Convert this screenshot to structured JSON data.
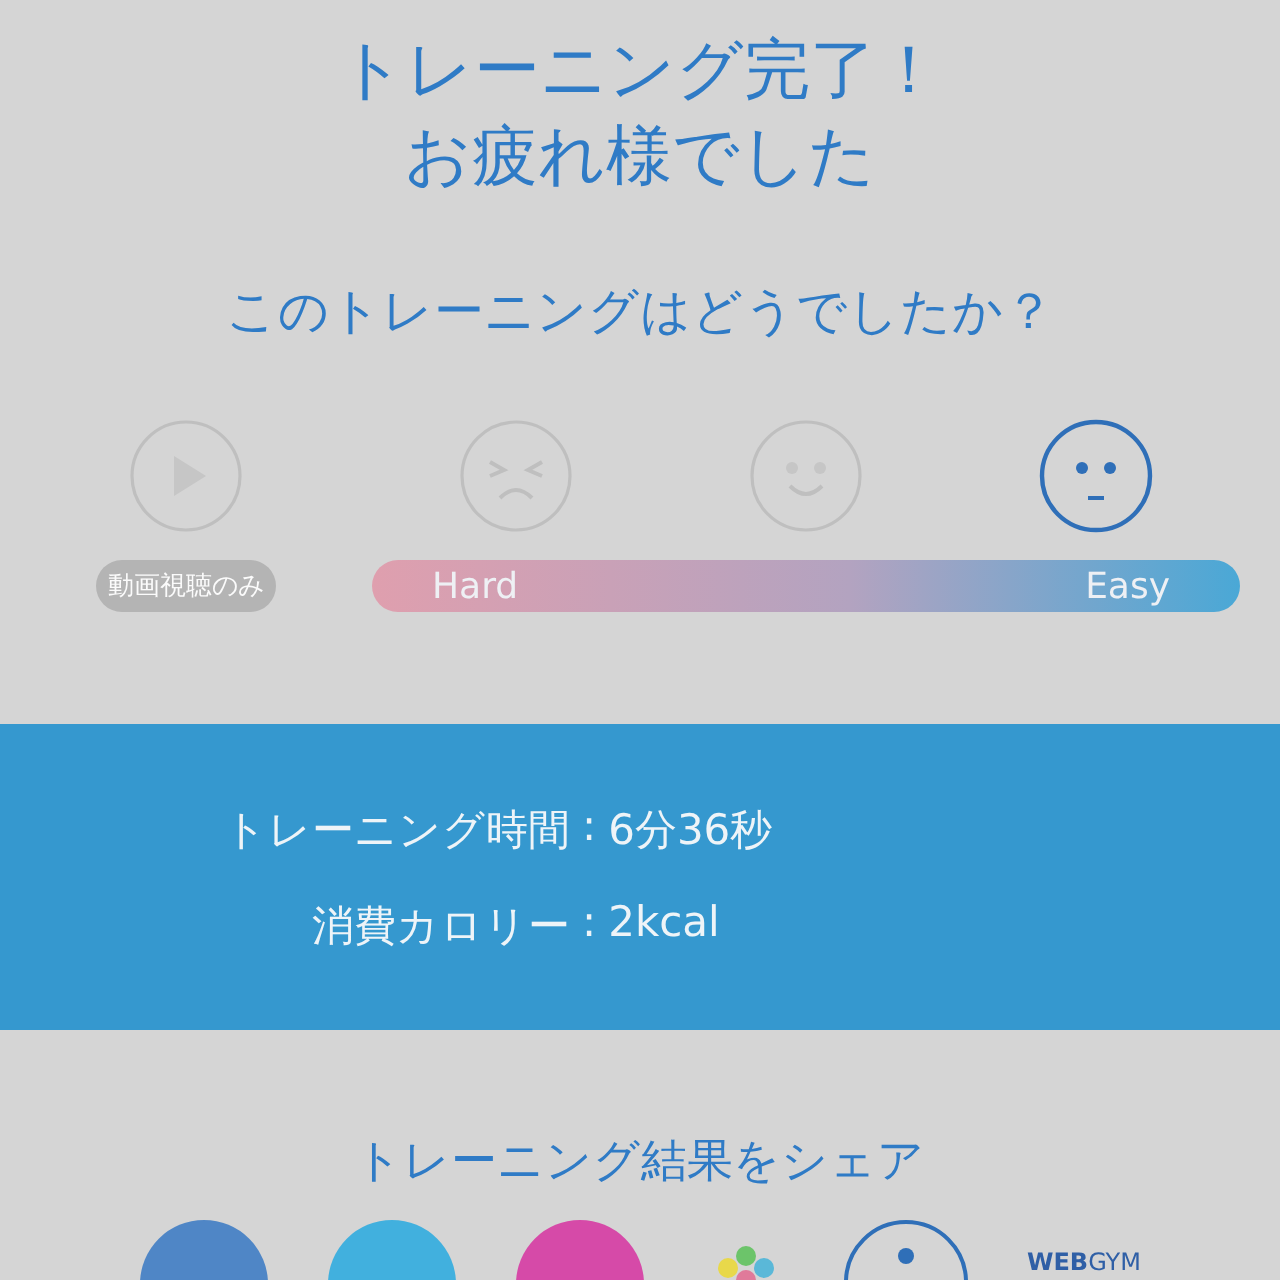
{
  "title_lines": [
    "トレーニング完了！",
    "お疲れ様でした"
  ],
  "question": "このトレーニングはどうでしたか？",
  "ratings": [
    {
      "kind": "video",
      "selected": false
    },
    {
      "kind": "hard",
      "selected": false
    },
    {
      "kind": "okay",
      "selected": false
    },
    {
      "kind": "easy",
      "selected": true
    }
  ],
  "video_only_label": "動画視聴のみ",
  "scale": {
    "low": "Hard",
    "high": "Easy"
  },
  "stats": [
    {
      "label": "トレーニング時間",
      "separator": ":",
      "value": "6分36秒"
    },
    {
      "label": "消費カロリー",
      "separator": ":",
      "value": "2kcal"
    }
  ],
  "share": {
    "title": "トレーニング結果をシェア",
    "items": [
      {
        "kind": "facebook"
      },
      {
        "kind": "twitter"
      },
      {
        "kind": "instagram"
      },
      {
        "kind": "dots"
      },
      {
        "kind": "ring"
      },
      {
        "kind": "brand",
        "text": "**WEB**GYM"
      }
    ]
  }
}
